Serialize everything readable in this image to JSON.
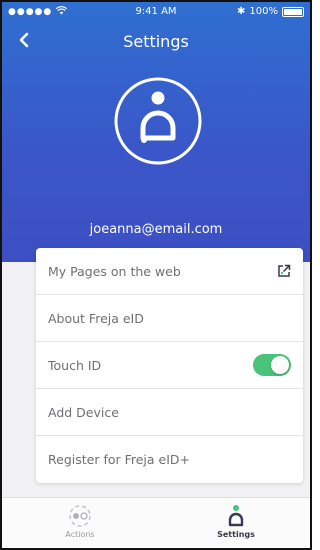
{
  "status_bar": {
    "signal": "●●●●●",
    "time": "9:41 AM",
    "bluetooth": "✱",
    "battery": "100%"
  },
  "header": {
    "title": "Settings"
  },
  "profile": {
    "email": "joeanna@email.com"
  },
  "settings_list": {
    "items": [
      {
        "label": "My Pages on the web",
        "icon": "external-link-icon"
      },
      {
        "label": "About Freja eID"
      },
      {
        "label": "Touch ID",
        "toggle_on": true
      },
      {
        "label": "Add Device"
      },
      {
        "label": "Register for Freja eID+"
      }
    ]
  },
  "tab_bar": {
    "tabs": [
      {
        "label": "Actions",
        "active": false,
        "icon": "actions-icon"
      },
      {
        "label": "Settings",
        "active": true,
        "icon": "settings-person-icon"
      }
    ]
  },
  "colors": {
    "header_top": "#2f6fd0",
    "header_bottom": "#3d4fc2",
    "toggle_on": "#49c27a",
    "active_dot": "#49c27a"
  }
}
